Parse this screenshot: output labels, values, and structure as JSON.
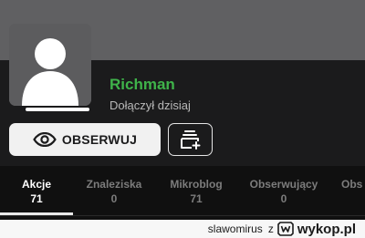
{
  "profile": {
    "username": "Richman",
    "joined_text": "Dołączył dzisiaj",
    "colors": {
      "username": "#3fb34a",
      "cover": "#606062",
      "band": "#1b1b1c"
    }
  },
  "actions": {
    "observe_label": "OBSERWUJ",
    "observe_icon": "eye-icon",
    "stack_icon": "add-to-collection-icon"
  },
  "tabs": [
    {
      "label": "Akcje",
      "count": "71",
      "active": true
    },
    {
      "label": "Znaleziska",
      "count": "0",
      "active": false
    },
    {
      "label": "Mikroblog",
      "count": "71",
      "active": false
    },
    {
      "label": "Obserwujący",
      "count": "0",
      "active": false
    },
    {
      "label": "Obs",
      "count": "",
      "active": false
    }
  ],
  "watermark": {
    "user": "slawomirus",
    "letter": "z",
    "site": "wykop.pl",
    "logo_icon": "wykop-logo-icon"
  }
}
